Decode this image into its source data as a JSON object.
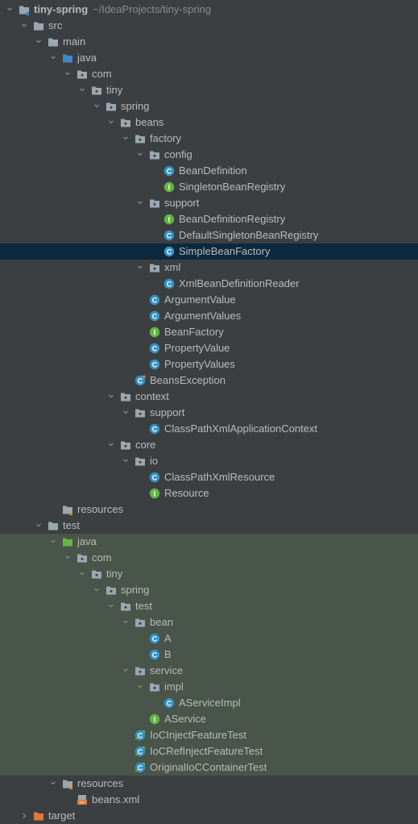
{
  "project": {
    "name": "tiny-spring",
    "path": "~/IdeaProjects/tiny-spring"
  },
  "colors": {
    "folder": "#9aa7b0",
    "source_folder": "#3d88c9",
    "test_folder": "#62b543",
    "resources_folder": "#9aa7b0",
    "excluded_folder": "#e0773b",
    "class": "#3592c4",
    "interface": "#62b543",
    "selection": "#0d293e",
    "test_band": "#49544a"
  },
  "tree": [
    {
      "label": "tiny-spring",
      "suffix": "~/IdeaProjects/tiny-spring",
      "depth": 0,
      "arrow": "down",
      "icon": "folder-module-icon",
      "bold": true
    },
    {
      "label": "src",
      "depth": 1,
      "arrow": "down",
      "icon": "folder-icon"
    },
    {
      "label": "main",
      "depth": 2,
      "arrow": "down",
      "icon": "folder-icon"
    },
    {
      "label": "java",
      "depth": 3,
      "arrow": "down",
      "icon": "source-folder-icon"
    },
    {
      "label": "com",
      "depth": 4,
      "arrow": "down",
      "icon": "package-icon"
    },
    {
      "label": "tiny",
      "depth": 5,
      "arrow": "down",
      "icon": "package-icon"
    },
    {
      "label": "spring",
      "depth": 6,
      "arrow": "down",
      "icon": "package-icon"
    },
    {
      "label": "beans",
      "depth": 7,
      "arrow": "down",
      "icon": "package-icon"
    },
    {
      "label": "factory",
      "depth": 8,
      "arrow": "down",
      "icon": "package-icon"
    },
    {
      "label": "config",
      "depth": 9,
      "arrow": "down",
      "icon": "package-icon"
    },
    {
      "label": "BeanDefinition",
      "depth": 10,
      "icon": "class-icon"
    },
    {
      "label": "SingletonBeanRegistry",
      "depth": 10,
      "icon": "interface-icon"
    },
    {
      "label": "support",
      "depth": 9,
      "arrow": "down",
      "icon": "package-icon"
    },
    {
      "label": "BeanDefinitionRegistry",
      "depth": 10,
      "icon": "interface-icon"
    },
    {
      "label": "DefaultSingletonBeanRegistry",
      "depth": 10,
      "icon": "class-icon"
    },
    {
      "label": "SimpleBeanFactory",
      "depth": 10,
      "icon": "class-icon",
      "selected": true
    },
    {
      "label": "xml",
      "depth": 9,
      "arrow": "down",
      "icon": "package-icon"
    },
    {
      "label": "XmlBeanDefinitionReader",
      "depth": 10,
      "icon": "class-icon"
    },
    {
      "label": "ArgumentValue",
      "depth": 9,
      "icon": "class-icon"
    },
    {
      "label": "ArgumentValues",
      "depth": 9,
      "icon": "class-icon"
    },
    {
      "label": "BeanFactory",
      "depth": 9,
      "icon": "interface-icon"
    },
    {
      "label": "PropertyValue",
      "depth": 9,
      "icon": "class-icon"
    },
    {
      "label": "PropertyValues",
      "depth": 9,
      "icon": "class-icon"
    },
    {
      "label": "BeansException",
      "depth": 8,
      "icon": "exception-class-icon"
    },
    {
      "label": "context",
      "depth": 7,
      "arrow": "down",
      "icon": "package-icon"
    },
    {
      "label": "support",
      "depth": 8,
      "arrow": "down",
      "icon": "package-icon"
    },
    {
      "label": "ClassPathXmlApplicationContext",
      "depth": 9,
      "icon": "class-icon"
    },
    {
      "label": "core",
      "depth": 7,
      "arrow": "down",
      "icon": "package-icon"
    },
    {
      "label": "io",
      "depth": 8,
      "arrow": "down",
      "icon": "package-icon"
    },
    {
      "label": "ClassPathXmlResource",
      "depth": 9,
      "icon": "class-icon"
    },
    {
      "label": "Resource",
      "depth": 9,
      "icon": "interface-icon"
    },
    {
      "label": "resources",
      "depth": 3,
      "icon": "resources-folder-icon"
    },
    {
      "label": "test",
      "depth": 2,
      "arrow": "down",
      "icon": "folder-icon"
    },
    {
      "label": "java",
      "depth": 3,
      "arrow": "down",
      "icon": "test-folder-icon",
      "test": true
    },
    {
      "label": "com",
      "depth": 4,
      "arrow": "down",
      "icon": "package-icon",
      "test": true
    },
    {
      "label": "tiny",
      "depth": 5,
      "arrow": "down",
      "icon": "package-icon",
      "test": true
    },
    {
      "label": "spring",
      "depth": 6,
      "arrow": "down",
      "icon": "package-icon",
      "test": true
    },
    {
      "label": "test",
      "depth": 7,
      "arrow": "down",
      "icon": "package-icon",
      "test": true
    },
    {
      "label": "bean",
      "depth": 8,
      "arrow": "down",
      "icon": "package-icon",
      "test": true
    },
    {
      "label": "A",
      "depth": 9,
      "icon": "class-icon",
      "test": true
    },
    {
      "label": "B",
      "depth": 9,
      "icon": "class-icon",
      "test": true
    },
    {
      "label": "service",
      "depth": 8,
      "arrow": "down",
      "icon": "package-icon",
      "test": true
    },
    {
      "label": "impl",
      "depth": 9,
      "arrow": "down",
      "icon": "package-icon",
      "test": true
    },
    {
      "label": "AServiceImpl",
      "depth": 10,
      "icon": "class-icon",
      "test": true
    },
    {
      "label": "AService",
      "depth": 9,
      "icon": "interface-icon",
      "test": true
    },
    {
      "label": "IoCInjectFeatureTest",
      "depth": 8,
      "icon": "test-class-icon",
      "test": true
    },
    {
      "label": "IoCRefInjectFeatureTest",
      "depth": 8,
      "icon": "test-class-icon",
      "test": true
    },
    {
      "label": "OriginalIoCContainerTest",
      "depth": 8,
      "icon": "test-class-icon",
      "test": true
    },
    {
      "label": "resources",
      "depth": 3,
      "arrow": "down",
      "icon": "test-resources-folder-icon"
    },
    {
      "label": "beans.xml",
      "depth": 4,
      "icon": "xml-file-icon"
    },
    {
      "label": "target",
      "depth": 1,
      "arrow": "right",
      "icon": "excluded-folder-icon"
    }
  ]
}
